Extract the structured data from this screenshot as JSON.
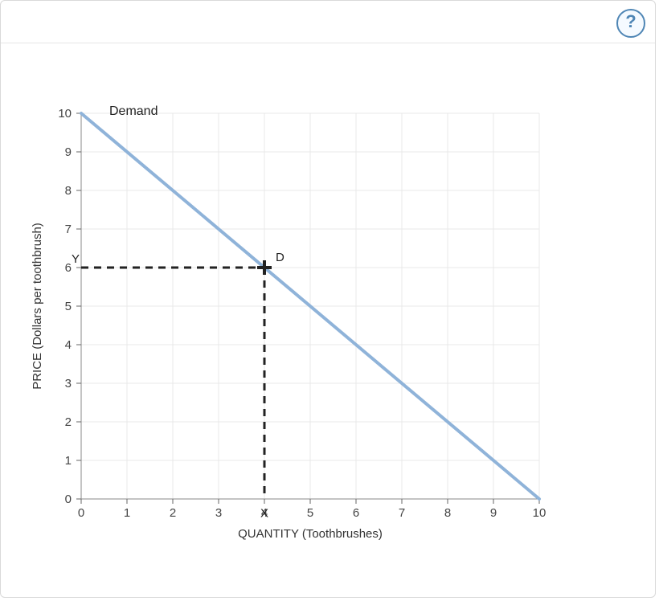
{
  "help_tooltip": "?",
  "chart_data": {
    "type": "line",
    "title": "",
    "xlabel": "QUANTITY (Toothbrushes)",
    "ylabel": "PRICE (Dollars per toothbrush)",
    "xlim": [
      0,
      10
    ],
    "ylim": [
      0,
      10
    ],
    "x_ticks": [
      0,
      1,
      2,
      3,
      4,
      5,
      6,
      7,
      8,
      9,
      10
    ],
    "y_ticks": [
      0,
      1,
      2,
      3,
      4,
      5,
      6,
      7,
      8,
      9,
      10
    ],
    "grid": true,
    "series": [
      {
        "name": "Demand",
        "x": [
          0,
          10
        ],
        "y": [
          10,
          0
        ],
        "color": "#8fb3d9"
      }
    ],
    "points": [
      {
        "name": "D",
        "x": 4,
        "y": 6
      }
    ],
    "guides": [
      {
        "axis": "x",
        "value": 4,
        "label": "X"
      },
      {
        "axis": "y",
        "value": 6,
        "label": "Y"
      }
    ]
  }
}
